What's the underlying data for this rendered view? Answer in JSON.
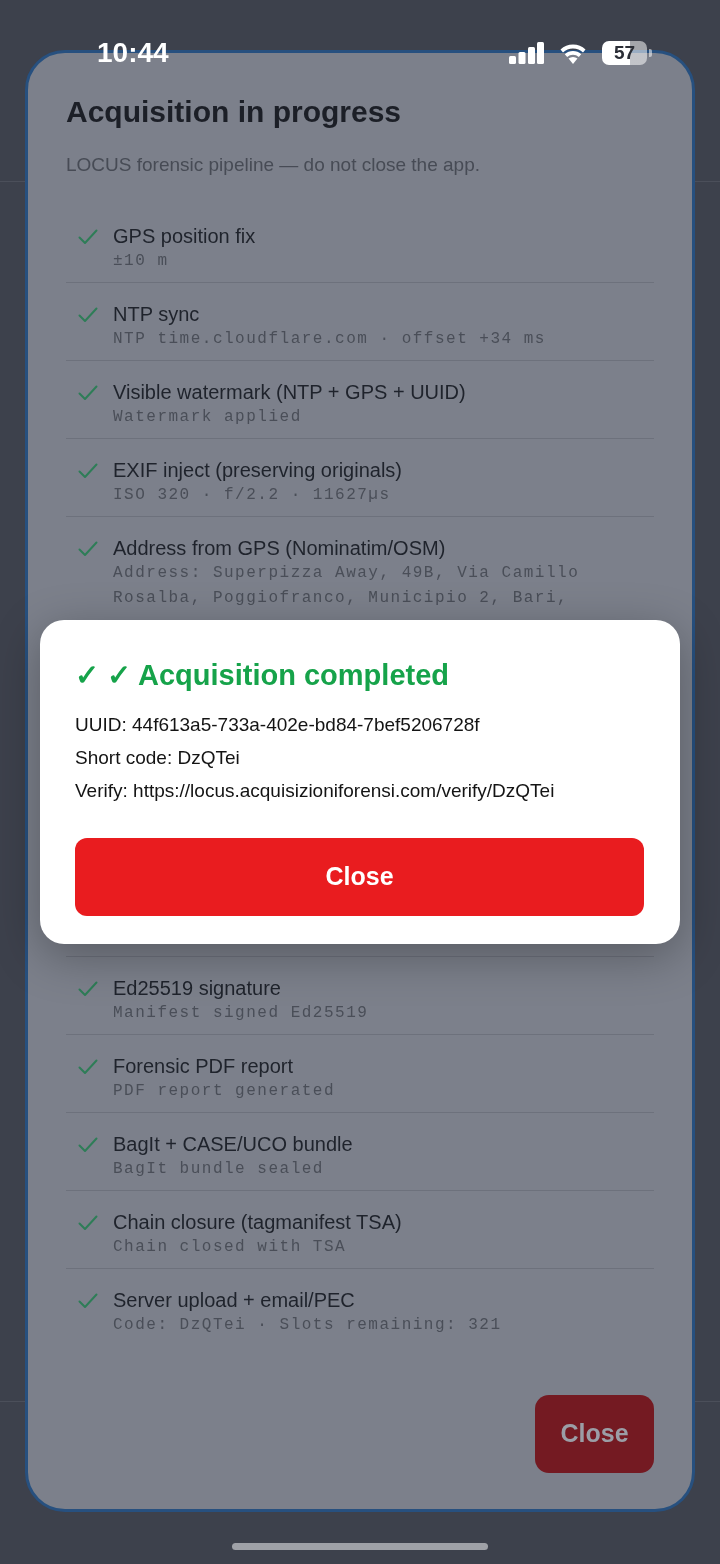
{
  "status_bar": {
    "time": "10:44",
    "battery": "57"
  },
  "sheet": {
    "title": "Acquisition in progress",
    "subtitle": "LOCUS forensic pipeline — do not close the app.",
    "steps_top": [
      {
        "title": "GPS position fix",
        "detail": "±10 m",
        "done": true
      },
      {
        "title": "NTP sync",
        "detail": "NTP time.cloudflare.com · offset +34 ms",
        "done": true
      },
      {
        "title": "Visible watermark (NTP + GPS + UUID)",
        "detail": "Watermark applied",
        "done": true
      },
      {
        "title": "EXIF inject (preserving originals)",
        "detail": "ISO 320 · f/2.2 · 11627µs",
        "done": true
      },
      {
        "title": "Address from GPS (Nominatim/OSM)",
        "detail": "Address: Superpizza Away, 49B, Via Camillo Rosalba, Poggiofranco, Municipio 2, Bari,",
        "done": true
      }
    ],
    "steps_bottom": [
      {
        "title": "Ed25519 signature",
        "detail": "Manifest signed Ed25519",
        "done": true
      },
      {
        "title": "Forensic PDF report",
        "detail": "PDF report generated",
        "done": true
      },
      {
        "title": "BagIt + CASE/UCO bundle",
        "detail": "BagIt bundle sealed",
        "done": true
      },
      {
        "title": "Chain closure (tagmanifest TSA)",
        "detail": "Chain closed with TSA",
        "done": true
      },
      {
        "title": "Server upload + email/PEC",
        "detail": "Code: DzQTei · Slots remaining: 321",
        "done": true
      }
    ],
    "close_button": "Close"
  },
  "dialog": {
    "title": "✓ ✓ Acquisition completed",
    "lines": [
      "UUID: 44f613a5-733a-402e-bd84-7bef5206728f",
      "Short code: DzQTei",
      "Verify: https://locus.acquisizioniforensi.com/verify/DzQTei"
    ],
    "button": "Close"
  }
}
